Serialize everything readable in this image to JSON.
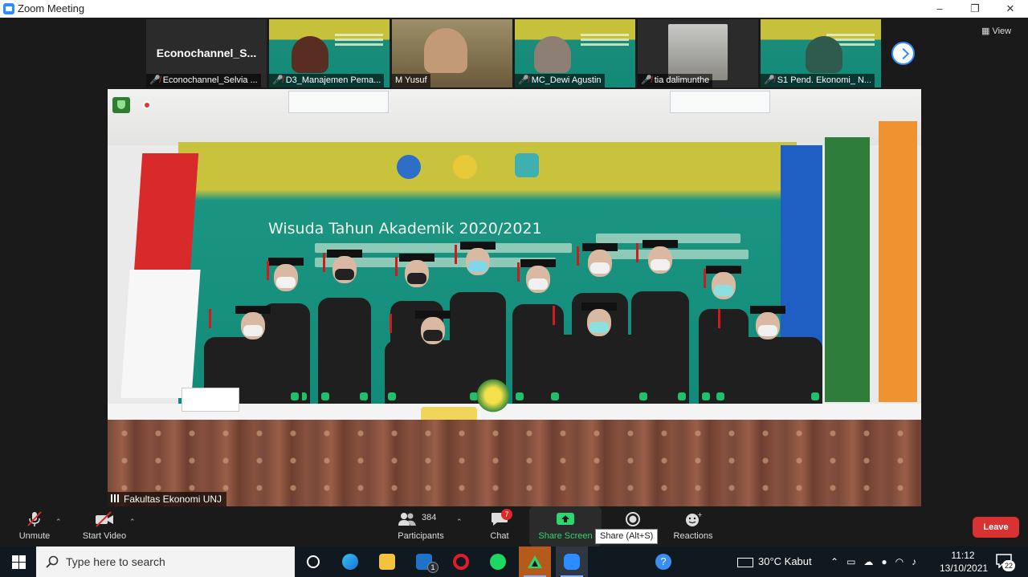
{
  "window": {
    "title": "Zoom Meeting",
    "minimize": "–",
    "restore": "❐",
    "close": "✕"
  },
  "view_button": "View",
  "thumbnails": [
    {
      "display_text": "Econochannel_S...",
      "label": "Econochannel_Selvia ...",
      "muted": true
    },
    {
      "label": "D3_Manajemen Pema...",
      "muted": true
    },
    {
      "label": "M Yusuf",
      "muted": false
    },
    {
      "label": "MC_Dewi Agustin",
      "muted": true
    },
    {
      "label": "tia dalimunthe",
      "muted": true
    },
    {
      "label": "S1 Pend. Ekonomi_ N...",
      "muted": true
    }
  ],
  "main_video": {
    "recording": "Recording",
    "speaker": "Fakultas Ekonomi UNJ",
    "banner_title": "Wisuda Tahun Akademik 2020/2021"
  },
  "toolbar": {
    "unmute": "Unmute",
    "start_video": "Start Video",
    "participants_count": "384",
    "participants": "Participants",
    "chat": "Chat",
    "chat_badge": "7",
    "share_screen": "Share Screen",
    "share_tooltip": "Share (Alt+S)",
    "reactions": "Reactions",
    "leave": "Leave"
  },
  "taskbar": {
    "search_placeholder": "Type here to search",
    "weather": "30°C  Kabut",
    "time": "11:12",
    "date": "13/10/2021",
    "notifications": "22",
    "mail_badge": "1"
  },
  "colors": {
    "accent": "#2d8cff",
    "share_green": "#2fd66f",
    "leave_red": "#d93232",
    "muted_red": "#e02828"
  }
}
